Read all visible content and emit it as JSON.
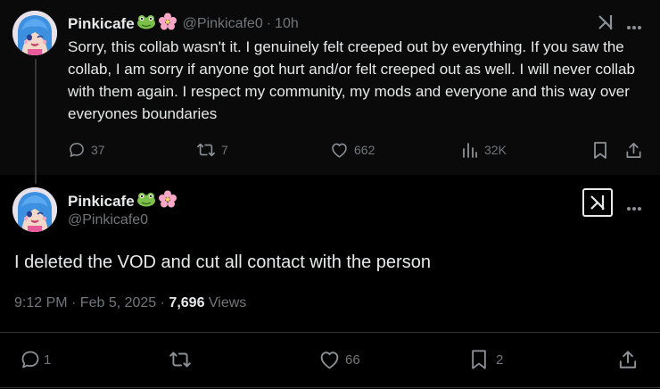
{
  "reply": {
    "display_name": "Pinkicafe",
    "name_emojis": [
      "frog-emoji",
      "cherry-blossom-emoji"
    ],
    "handle": "@Pinkicafe0",
    "separator": "·",
    "time": "10h",
    "text": "Sorry, this collab wasn't it. I genuinely felt creeped out by everything. If you saw the collab, I am sorry if anyone got hurt and/or felt creeped out as well. I will never collab with them again. I respect my community, my mods and everyone and this way over everyones boundaries",
    "stats": {
      "replies": "37",
      "reposts": "7",
      "likes": "662",
      "views": "32K"
    }
  },
  "main": {
    "display_name": "Pinkicafe",
    "handle": "@Pinkicafe0",
    "text": "I deleted the VOD and cut all contact with the person",
    "timestamp": "9:12 PM · Feb 5, 2025 · ",
    "views_count": "7,696",
    "views_label": " Views",
    "stats": {
      "replies": "1",
      "reposts": "",
      "likes": "66",
      "bookmarks": "2"
    }
  },
  "icons": [
    "grok-icon",
    "more-icon",
    "reply-icon",
    "repost-icon",
    "like-icon",
    "views-icon",
    "bookmark-icon",
    "share-icon"
  ],
  "colors": {
    "background": "#000000",
    "text": "#e7e9ea",
    "muted": "#71767b",
    "divider": "#2f3336"
  }
}
